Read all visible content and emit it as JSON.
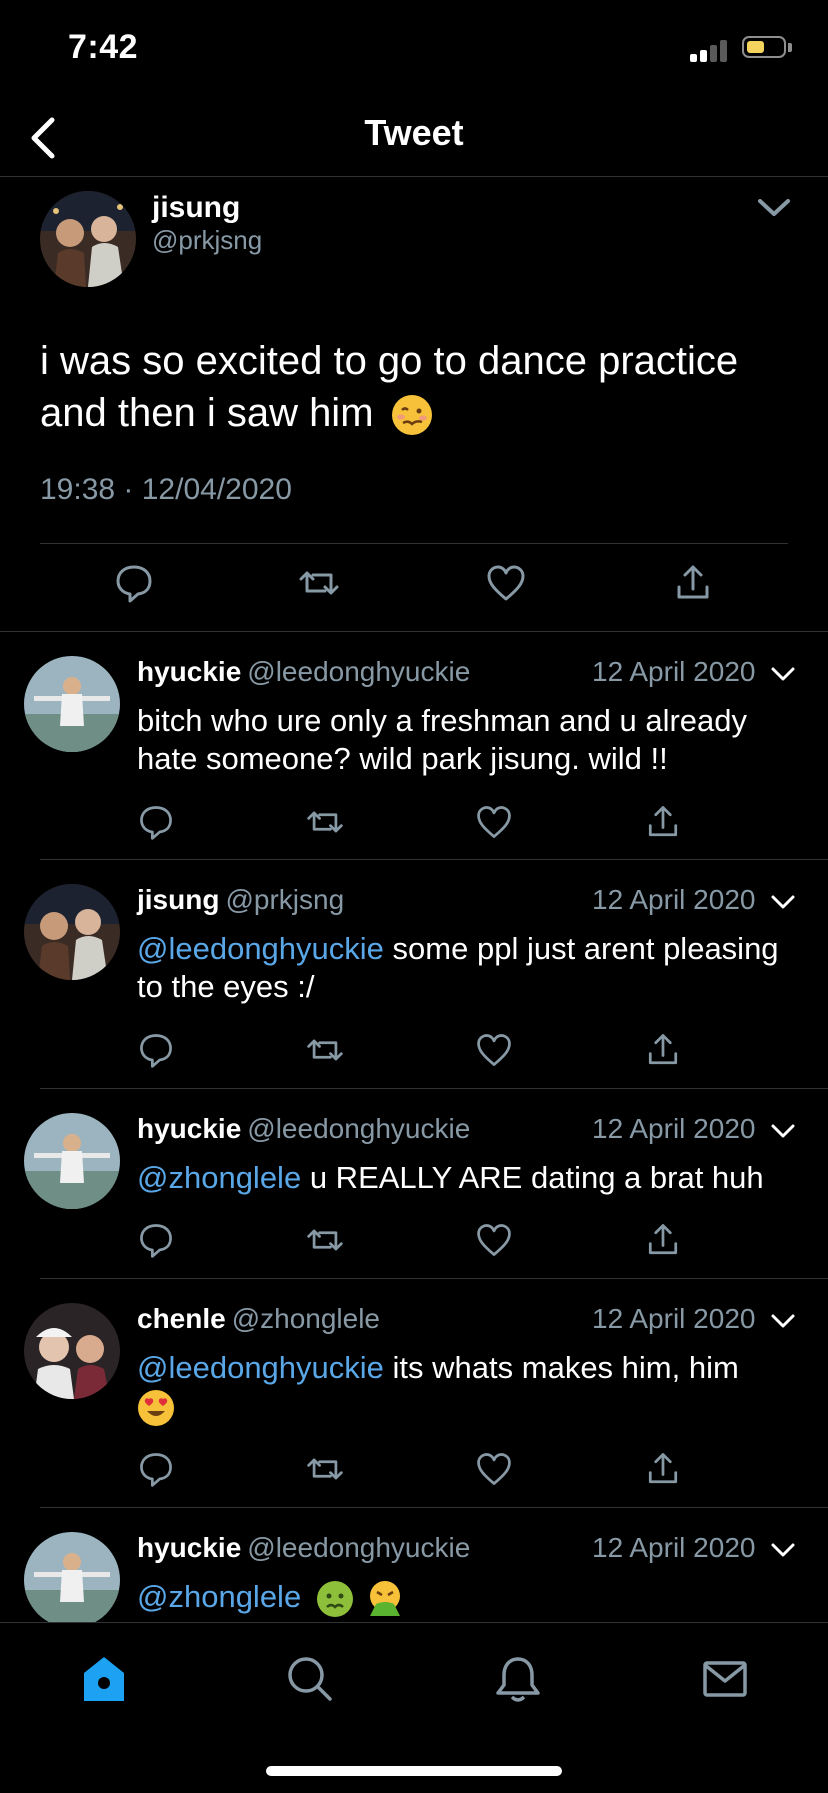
{
  "status_bar": {
    "time": "7:42"
  },
  "header": {
    "title": "Tweet"
  },
  "main_tweet": {
    "name": "jisung",
    "handle": "@prkjsng",
    "text": "i was so excited to go to dance practice and then i saw him",
    "emoji": "woozy-face",
    "time": "19:38",
    "date": "12/04/2020"
  },
  "replies": [
    {
      "name": "hyuckie",
      "handle": "@leedonghyuckie",
      "date": "12 April 2020",
      "mention": "",
      "text": "bitch who ure only a freshman and u already hate someone? wild park jisung. wild !!",
      "emojis": []
    },
    {
      "name": "jisung",
      "handle": "@prkjsng",
      "date": "12 April 2020",
      "mention": "@leedonghyuckie",
      "text": "some ppl just arent pleasing to the eyes :/",
      "emojis": []
    },
    {
      "name": "hyuckie",
      "handle": "@leedonghyuckie",
      "date": "12 April 2020",
      "mention": "@zhonglele",
      "text": "u REALLY ARE dating a brat huh",
      "emojis": []
    },
    {
      "name": "chenle",
      "handle": "@zhonglele",
      "date": "12 April 2020",
      "mention": "@leedonghyuckie",
      "text": "its whats makes him, him",
      "emojis": [
        "heart-eyes-face"
      ]
    },
    {
      "name": "hyuckie",
      "handle": "@leedonghyuckie",
      "date": "12 April 2020",
      "mention": "@zhonglele",
      "text": "",
      "emojis": [
        "nauseated-face",
        "vomiting-face"
      ]
    }
  ],
  "tabbar": [
    "home-icon",
    "search-icon",
    "bell-icon",
    "mail-icon"
  ],
  "colors": {
    "accent": "#1da1f2",
    "mention": "#5aa7e8",
    "muted": "#8899a6",
    "background": "#000000",
    "divider": "#2f3336"
  }
}
